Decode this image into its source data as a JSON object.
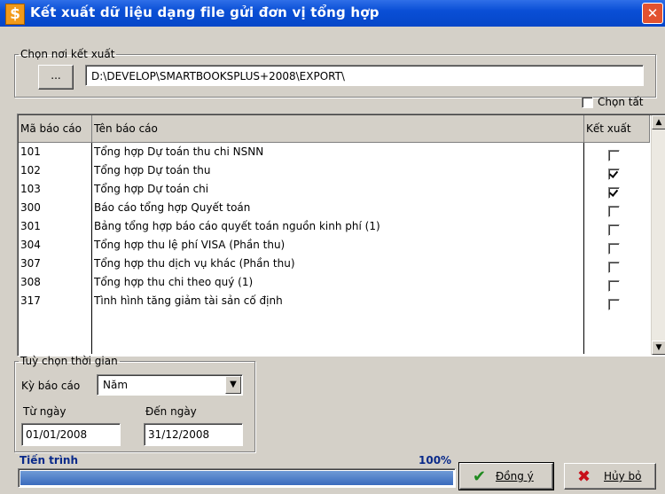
{
  "window": {
    "title": "Kết xuất dữ liệu dạng file gửi đơn vị tổng hợp",
    "icon": "$",
    "close": "✕"
  },
  "export_location": {
    "legend": "Chọn nơi kết xuất",
    "browse_label": "...",
    "path": "D:\\DEVELOP\\SMARTBOOKSPLUS+2008\\EXPORT\\"
  },
  "select_all_label": "Chọn tất",
  "table": {
    "headers": {
      "code": "Mã báo cáo",
      "name": "Tên báo cáo",
      "export": "Kết xuất"
    },
    "rows": [
      {
        "code": "101",
        "name": "Tổng hợp Dự toán thu chi NSNN",
        "checked": false
      },
      {
        "code": "102",
        "name": "Tổng hợp Dự toán thu",
        "checked": true
      },
      {
        "code": "103",
        "name": "Tổng hợp Dự toán chi",
        "checked": true
      },
      {
        "code": "300",
        "name": "Báo cáo tổng hợp Quyết toán",
        "checked": false
      },
      {
        "code": "301",
        "name": "Bảng tổng hợp báo cáo quyết toán nguồn kinh phí (1)",
        "checked": false
      },
      {
        "code": "304",
        "name": "Tổng hợp thu lệ phí VISA (Phần thu)",
        "checked": false
      },
      {
        "code": "307",
        "name": "Tổng hợp thu dịch vụ khác (Phần thu)",
        "checked": false
      },
      {
        "code": "308",
        "name": "Tổng hợp thu chi theo quý (1)",
        "checked": false
      },
      {
        "code": "317",
        "name": "Tình hình tăng giảm tài sản cố định",
        "checked": false
      }
    ]
  },
  "time_options": {
    "legend": "Tuỳ chọn thời gian",
    "period_label": "Kỳ báo cáo",
    "period_value": "Năm",
    "from_label": "Từ ngày",
    "from_value": "01/01/2008",
    "to_label": "Đến ngày",
    "to_value": "31/12/2008"
  },
  "progress": {
    "label": "Tiến trình",
    "percent_text": "100%",
    "value": 1.0
  },
  "buttons": {
    "ok": "Đồng ý",
    "cancel": "Hủy bỏ"
  },
  "colors": {
    "titlebar": "#0a4fd6",
    "progress_fill": "#3a6bbd",
    "progress_text": "#0a2a8a"
  }
}
